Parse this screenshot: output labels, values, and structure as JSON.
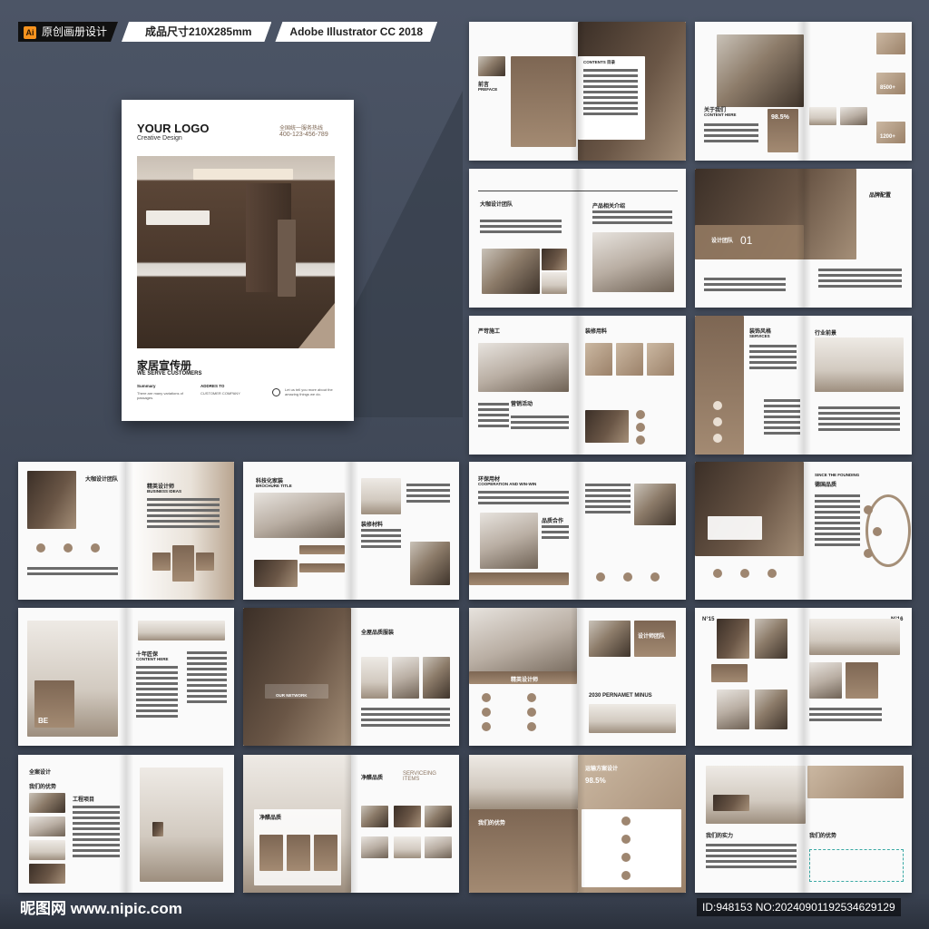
{
  "header": {
    "ai_icon": "Ai",
    "badges": [
      "原创画册设计",
      "成品尺寸210X285mm",
      "Adobe Illustrator CC 2018"
    ]
  },
  "cover": {
    "logo": "YOUR LOGO",
    "logo_sub": "Creative Design",
    "contact_label": "全国统一服务热线",
    "phone": "400-123-456-789",
    "title_cn": "家居宣传册",
    "title_en": "WE SERVE CUSTOMERS",
    "summary_label": "Summary",
    "summary_text": "There are many variations of passages.",
    "address_label": "ADDRES TO",
    "address_text": "CUSTOMER COMPANY",
    "tagline": "Let us tell you more about the amazing things we do."
  },
  "spreads": {
    "s1": {
      "h1": "前言",
      "h2": "PREFACE",
      "h3": "CONTENTS 目录"
    },
    "s2": {
      "h1": "关于我们",
      "h2": "CONTENT HERE",
      "stats": [
        "98.5%",
        "8500+",
        "1200+"
      ]
    },
    "s3": {
      "h1": "大咖设计团队",
      "h2": "产品相关介绍"
    },
    "s4": {
      "h1": "设计团队",
      "h2": "品牌配置",
      "num": "01"
    },
    "s5": {
      "h1": "严苛施工",
      "h2": "装修用料",
      "h3": "营销活动"
    },
    "s6": {
      "h1": "装饰风格",
      "h2": "SERVICES",
      "h3": "行业前景"
    },
    "s7": {
      "h1": "大咖设计团队",
      "h2": "精英设计师",
      "h3": "BUSINESS IDEAS"
    },
    "s8": {
      "h1": "科技化家装",
      "h2": "BROCHURE TITLE",
      "h3": "装修材料"
    },
    "s9": {
      "h1": "环保用材",
      "h2": "COOPERATION AND WIN-WIN",
      "h3": "品质合作"
    },
    "s10": {
      "h1": "德国品质",
      "h2": "SINCE THE FOUNDING"
    },
    "s11": {
      "h1": "十年匠保",
      "h2": "CONTENT HERE",
      "h3": "BE"
    },
    "s12": {
      "h1": "全屋品质服装",
      "h2": "OUR NETWORK"
    },
    "s13": {
      "h1": "精英设计师",
      "h2": "设计师团队",
      "h3": "2030 PERNAMET MINUS"
    },
    "s14": {
      "h1": "N°15",
      "h2": "N°16"
    },
    "s15": {
      "h1": "全案设计",
      "h2": "我们的优势",
      "h3": "工程项目"
    },
    "s16": {
      "h1": "净醛品质",
      "h2": "SERVICEING ITEMS"
    },
    "s17": {
      "h1": "运输方案设计",
      "h2": "98.5%",
      "h3": "我们的优势"
    },
    "s18": {
      "h1": "我们的实力",
      "h2": "我们的优势"
    }
  },
  "footer": {
    "watermark_left": "昵图网 www.nipic.com",
    "watermark_right": "ID:948153 NO:20240901192534629129"
  }
}
